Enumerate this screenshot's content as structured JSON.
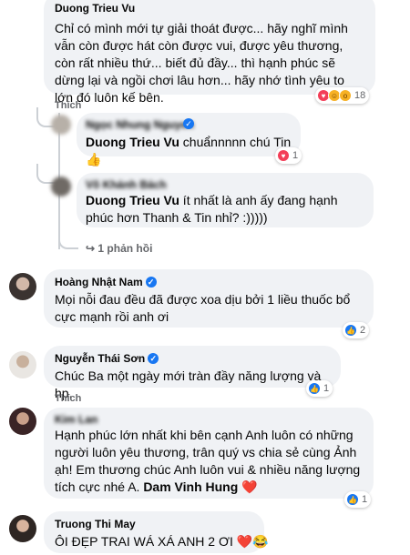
{
  "comments": [
    {
      "author": "Duong Trieu Vu",
      "text": "Chỉ có mình mới tự giải thoát được... hãy nghĩ mình vẫn còn được hát còn được vui, được yêu thương, còn rất nhiều thứ... biết đủ đầy... thì hạnh phúc sẽ dừng lại và ngồi chơi lâu hơn... hãy nhớ tình yêu to lớn đó luôn kế bên.",
      "like_label": "Thích",
      "reaction_count": "18"
    },
    {
      "author": "Ngọc Nhung Nguyen",
      "tag": "Duong Trieu Vu",
      "text": " chuẩnnnnn chú Tin",
      "emoji": "👍",
      "reaction_count": "1"
    },
    {
      "author": "Võ Khánh Bách",
      "tag": "Duong Trieu Vu",
      "text": " ít nhất là anh ấy đang hạnh phúc hơn Thanh & Tin nhỉ? :)))))",
      "replies_label": "1 phản hồi"
    },
    {
      "author": "Hoàng Nhật Nam",
      "text": "Mọi nỗi đau đều đã được xoa dịu bởi 1 liều thuốc bổ cực mạnh rồi anh ơi",
      "reaction_count": "2"
    },
    {
      "author": "Nguyễn Thái Sơn",
      "text": "Chúc Ba một ngày mới tràn đầy năng lượng và hp.",
      "like_label": "Thích",
      "reaction_count": "1"
    },
    {
      "author": "Kim Lan",
      "text": "Hạnh phúc lớn nhất khi bên cạnh Anh luôn có những người luôn yêu thương, trân quý vs chia sẻ cùng Ảnh ạh! Em thương chúc Anh luôn vui & nhiều năng lượng tích cực nhé A. ",
      "tag": "Dam Vinh Hung",
      "emoji": "❤️",
      "reaction_count": "1"
    },
    {
      "author": "Truong Thi May",
      "text": "ÔI ĐẸP TRAI WÁ XÁ ANH 2 ƠI ",
      "emoji": "❤️😂"
    }
  ],
  "icons": [
    "verified-badge-icon",
    "love-reaction-icon",
    "haha-reaction-icon",
    "wow-reaction-icon",
    "like-reaction-icon",
    "reply-arrow-icon"
  ],
  "colors": {
    "bubble": "#f0f2f5",
    "verified": "#1877f2",
    "love": "#f33e58",
    "like": "#1877f2",
    "meta": "#65676b"
  }
}
